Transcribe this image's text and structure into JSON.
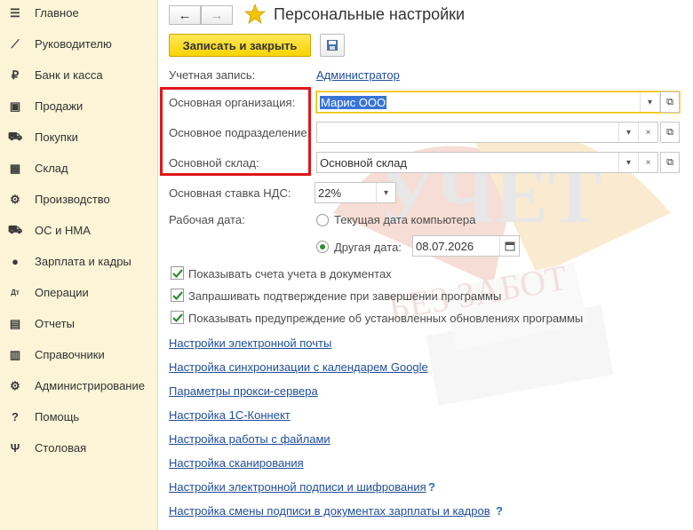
{
  "sidebar": {
    "items": [
      {
        "label": "Главное",
        "icon": "☰",
        "icon_name": "menu-icon"
      },
      {
        "label": "Руководителю",
        "icon": "⟋",
        "icon_name": "trend-chart-icon"
      },
      {
        "label": "Банк и касса",
        "icon": "₽",
        "icon_name": "ruble-coin-icon"
      },
      {
        "label": "Продажи",
        "icon": "▣",
        "icon_name": "shopping-bag-icon"
      },
      {
        "label": "Покупки",
        "icon": "⛟",
        "icon_name": "shopping-cart-icon"
      },
      {
        "label": "Склад",
        "icon": "▦",
        "icon_name": "warehouse-grid-icon"
      },
      {
        "label": "Производство",
        "icon": "⚙",
        "icon_name": "factory-icon"
      },
      {
        "label": "ОС и НМА",
        "icon": "⛟",
        "icon_name": "truck-icon"
      },
      {
        "label": "Зарплата и кадры",
        "icon": "●",
        "icon_name": "person-icon"
      },
      {
        "label": "Операции",
        "icon": "Дт",
        "icon_name": "dt-kt-icon"
      },
      {
        "label": "Отчеты",
        "icon": "▤",
        "icon_name": "report-icon"
      },
      {
        "label": "Справочники",
        "icon": "▥",
        "icon_name": "books-icon"
      },
      {
        "label": "Администрирование",
        "icon": "⚙",
        "icon_name": "gear-icon"
      },
      {
        "label": "Помощь",
        "icon": "?",
        "icon_name": "help-icon"
      },
      {
        "label": "Столовая",
        "icon": "Ψ",
        "icon_name": "fork-knife-icon"
      }
    ]
  },
  "header": {
    "title": "Персональные настройки",
    "back_glyph": "←",
    "forward_glyph": "→"
  },
  "toolbar": {
    "save_close_label": "Записать и закрыть"
  },
  "form": {
    "account_label": "Учетная запись:",
    "account_value": "Администратор",
    "org_label": "Основная организация:",
    "org_value": "Марис ООО",
    "division_label": "Основное подразделение:",
    "division_value": "",
    "warehouse_label": "Основной склад:",
    "warehouse_value": "Основной склад",
    "vat_label": "Основная ставка НДС:",
    "vat_value": "22%",
    "workdate_label": "Рабочая дата:",
    "radio_current": "Текущая дата компьютера",
    "radio_other": "Другая дата:",
    "other_date_value": "08.07.2026",
    "selected_radio": "other"
  },
  "checkboxes": [
    {
      "label": "Показывать счета учета в документах",
      "checked": true
    },
    {
      "label": "Запрашивать подтверждение при завершении программы",
      "checked": true
    },
    {
      "label": "Показывать предупреждение об установленных обновлениях программы",
      "checked": true
    }
  ],
  "links": [
    {
      "label": "Настройки электронной почты",
      "help": ""
    },
    {
      "label": "Настройка синхронизации с календарем Google",
      "help": ""
    },
    {
      "label": "Параметры прокси-сервера",
      "help": ""
    },
    {
      "label": "Настройка 1С-Коннект",
      "help": ""
    },
    {
      "label": "Настройка работы с файлами",
      "help": ""
    },
    {
      "label": "Настройка сканирования",
      "help": ""
    },
    {
      "label": "Настройки электронной подписи и шифрования",
      "help": "?"
    },
    {
      "label": "Настройка смены подписи в документах зарплаты и кадров",
      "help": "?"
    }
  ],
  "colors": {
    "sidebar_bg": "#fbf4d6",
    "primary_button": "#f8d400",
    "link": "#1f4e9a",
    "highlight_box": "#e0161b",
    "star": "#f5c400"
  }
}
